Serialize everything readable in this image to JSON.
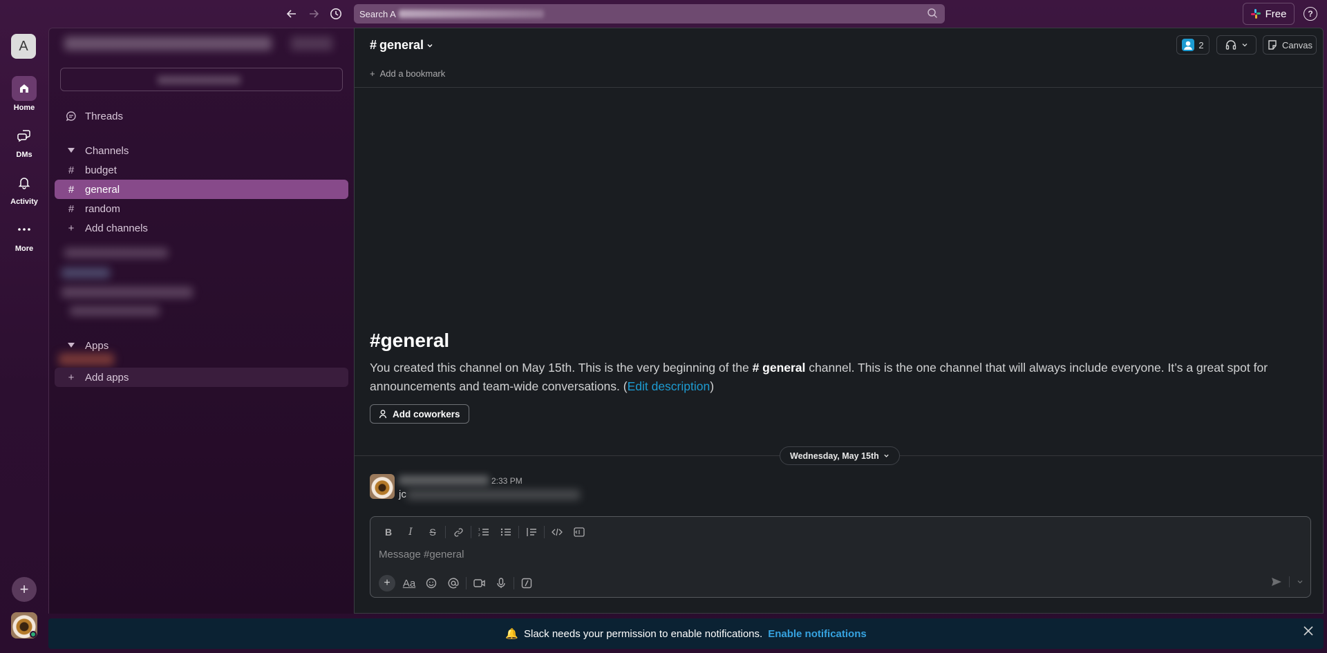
{
  "topbar": {
    "search_prefix": "Search A",
    "free_label": "Free",
    "help_label": "?"
  },
  "rail": {
    "workspace_initial": "A",
    "items": [
      {
        "label": "Home"
      },
      {
        "label": "DMs"
      },
      {
        "label": "Activity"
      },
      {
        "label": "More"
      }
    ]
  },
  "sidebar": {
    "threads_label": "Threads",
    "channels_header": "Channels",
    "channels": [
      {
        "name": "budget"
      },
      {
        "name": "general"
      },
      {
        "name": "random"
      }
    ],
    "add_channels_label": "Add channels",
    "apps_header": "Apps",
    "add_apps_label": "Add apps"
  },
  "channel": {
    "title": "general",
    "member_count": "2",
    "canvas_label": "Canvas",
    "add_bookmark_label": "Add a bookmark",
    "intro_title": "general",
    "intro_text_1": "You created this channel on May 15th. This is the very beginning of the ",
    "intro_channel": "# general",
    "intro_text_2": " channel. This is the one channel that will always include everyone. It’s a great spot for announcements and team-wide conversations. (",
    "edit_description_label": "Edit description",
    "intro_text_3": ")",
    "add_coworkers_label": "Add coworkers",
    "date_divider": "Wednesday, May 15th"
  },
  "message": {
    "time": "2:33 PM",
    "text_prefix": "jc"
  },
  "composer": {
    "placeholder": "Message #general"
  },
  "banner": {
    "text": "Slack needs your permission to enable notifications.",
    "link": "Enable notifications"
  },
  "colors": {
    "accent_active": "#874a8a",
    "link": "#1d9bd1",
    "main_bg": "#1a1d21"
  }
}
